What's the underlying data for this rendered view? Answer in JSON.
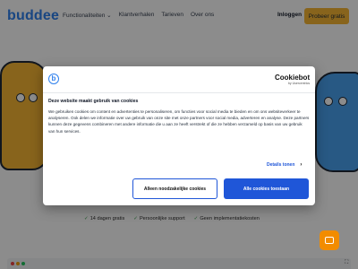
{
  "header": {
    "logo": "buddee",
    "nav": [
      "Functionaliteiten",
      "Klantverhalen",
      "Tarieven",
      "Over ons"
    ],
    "nav_chevron": "chevron-down-icon",
    "login": "Inloggen",
    "trial": "Probeer gratis"
  },
  "perks": [
    "14 dagen gratis",
    "Persoonlijke support",
    "Geen implementatiekosten"
  ],
  "cookie_dialog": {
    "logo_letter": "b",
    "brand": "Cookiebot",
    "brand_by": "by Usercentrics",
    "title": "Deze website maakt gebruik van cookies",
    "body": "We gebruiken cookies om content en advertenties te personaliseren, om functies voor social media te bieden en om ons websiteverkeer te analyseren. Ook delen we informatie over uw gebruik van onze site met onze partners voor social media, adverteren en analyse. Deze partners kunnen deze gegevens combineren met andere informatie die u aan ze heeft verstrekt of die ze hebben verzameld op basis van uw gebruik van hun services.",
    "details_label": "Details tonen",
    "necessary_label": "Alleen noodzakelijke cookies",
    "allow_all_label": "Alle cookies toestaan"
  },
  "colors": {
    "accent": "#1f56d8",
    "brand_blue": "#2f80ed",
    "brand_yellow": "#f7b733",
    "chat_orange": "#f28c00"
  },
  "icons": {
    "chat": "chat-bubble-icon",
    "check": "check-icon",
    "expand": "expand-icon"
  }
}
